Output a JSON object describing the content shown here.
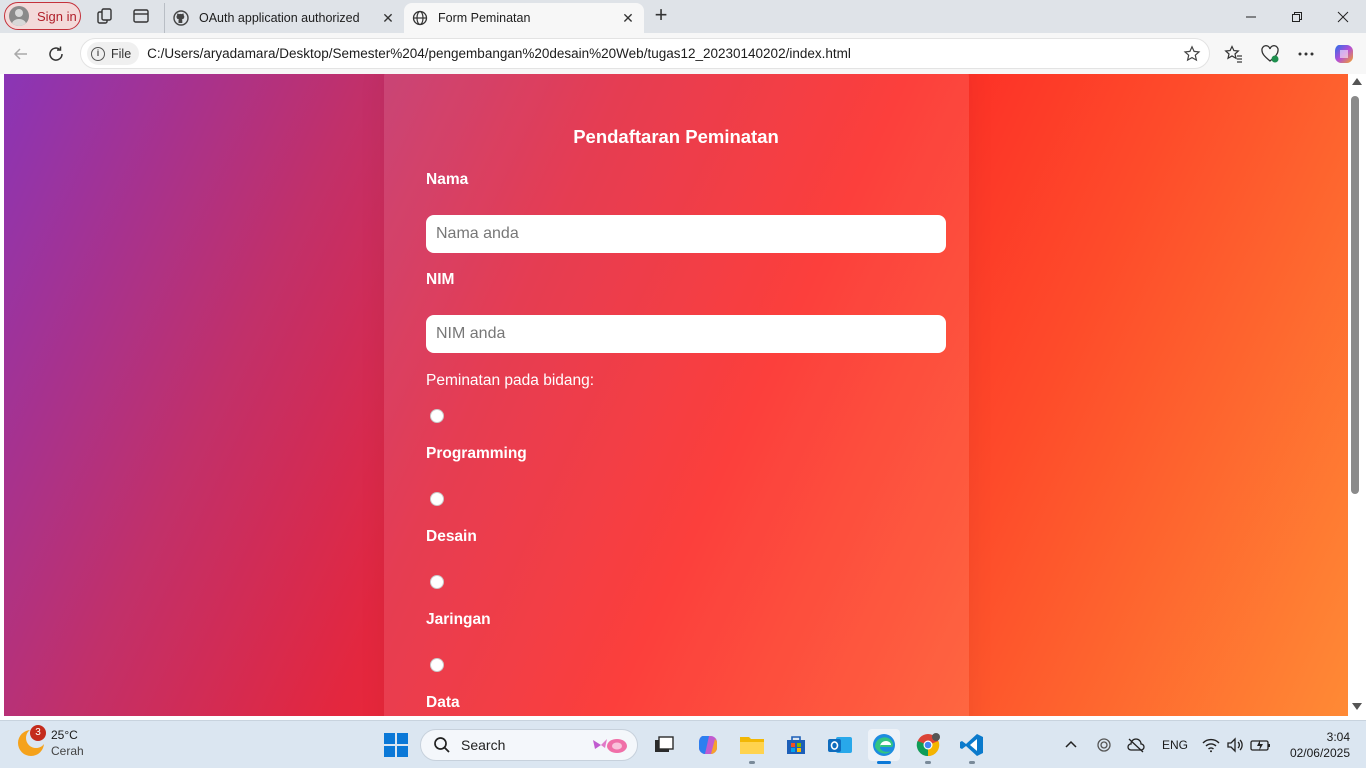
{
  "browser": {
    "signin_label": "Sign in",
    "tabs": [
      {
        "title": "OAuth application authorized",
        "favicon": "github-icon",
        "active": false
      },
      {
        "title": "Form Peminatan",
        "favicon": "globe-icon",
        "active": true
      }
    ],
    "file_chip": "File",
    "url": "C:/Users/aryadamara/Desktop/Semester%204/pengembangan%20desain%20Web/tugas12_20230140202/index.html"
  },
  "page": {
    "title": "Pendaftaran Peminatan",
    "name_label": "Nama",
    "name_placeholder": "Nama anda",
    "nim_label": "NIM",
    "nim_placeholder": "NIM anda",
    "interest_label": "Peminatan pada bidang:",
    "options": [
      "Programming",
      "Desain",
      "Jaringan",
      "Data"
    ],
    "colors": {
      "gradient_start": "#8a35b6",
      "gradient_mid": "#fc2a26",
      "gradient_end": "#ff8a35"
    }
  },
  "taskbar": {
    "weather_badge": "3",
    "weather_temp": "25°C",
    "weather_cond": "Cerah",
    "search_label": "Search",
    "lang": "ENG",
    "time": "3:04",
    "date": "02/06/2025"
  }
}
